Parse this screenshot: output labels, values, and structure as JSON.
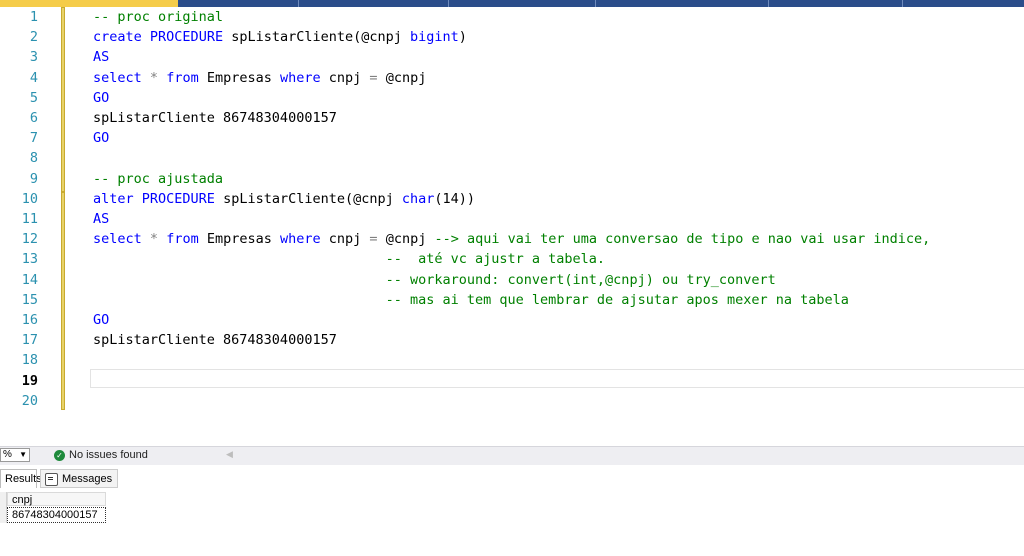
{
  "editor": {
    "line_numbers": [
      "1",
      "2",
      "3",
      "4",
      "5",
      "6",
      "7",
      "8",
      "9",
      "10",
      "11",
      "12",
      "13",
      "14",
      "15",
      "16",
      "17",
      "18",
      "19",
      "20"
    ],
    "current_line": "19",
    "lines": [
      [
        {
          "t": "-- proc original",
          "c": "cm"
        }
      ],
      [
        {
          "t": "create",
          "c": "kw"
        },
        {
          "t": " "
        },
        {
          "t": "PROCEDURE",
          "c": "kw"
        },
        {
          "t": " spListarCliente(@cnpj "
        },
        {
          "t": "bigint",
          "c": "kw"
        },
        {
          "t": ")"
        }
      ],
      [
        {
          "t": "AS",
          "c": "kw"
        }
      ],
      [
        {
          "t": "select",
          "c": "kw"
        },
        {
          "t": " "
        },
        {
          "t": "*",
          "c": "gr"
        },
        {
          "t": " "
        },
        {
          "t": "from",
          "c": "kw"
        },
        {
          "t": " Empresas "
        },
        {
          "t": "where",
          "c": "kw"
        },
        {
          "t": " cnpj "
        },
        {
          "t": "=",
          "c": "gr"
        },
        {
          "t": " @cnpj"
        }
      ],
      [
        {
          "t": "GO",
          "c": "kw"
        }
      ],
      [
        {
          "t": "spListarCliente 86748304000157"
        }
      ],
      [
        {
          "t": "GO",
          "c": "kw"
        }
      ],
      [],
      [
        {
          "t": "-- proc ajustada",
          "c": "cm"
        }
      ],
      [
        {
          "t": "alter",
          "c": "kw"
        },
        {
          "t": " "
        },
        {
          "t": "PROCEDURE",
          "c": "kw"
        },
        {
          "t": " spListarCliente(@cnpj "
        },
        {
          "t": "char",
          "c": "kw"
        },
        {
          "t": "(14))"
        }
      ],
      [
        {
          "t": "AS",
          "c": "kw"
        }
      ],
      [
        {
          "t": "select",
          "c": "kw"
        },
        {
          "t": " "
        },
        {
          "t": "*",
          "c": "gr"
        },
        {
          "t": " "
        },
        {
          "t": "from",
          "c": "kw"
        },
        {
          "t": " Empresas "
        },
        {
          "t": "where",
          "c": "kw"
        },
        {
          "t": " cnpj "
        },
        {
          "t": "=",
          "c": "gr"
        },
        {
          "t": " @cnpj "
        },
        {
          "t": "--> aqui vai ter uma conversao de tipo e nao vai usar indice,",
          "c": "cm"
        }
      ],
      [
        {
          "t": "                                    "
        },
        {
          "t": "--  até vc ajustr a tabela.",
          "c": "cm"
        }
      ],
      [
        {
          "t": "                                    "
        },
        {
          "t": "-- workaround: convert(int,@cnpj) ou try_convert",
          "c": "cm"
        }
      ],
      [
        {
          "t": "                                    "
        },
        {
          "t": "-- mas ai tem que lembrar de ajsutar apos mexer na tabela",
          "c": "cm"
        }
      ],
      [
        {
          "t": "GO",
          "c": "kw"
        }
      ],
      [
        {
          "t": "spListarCliente 86748304000157"
        }
      ],
      [],
      [],
      []
    ]
  },
  "statusbar": {
    "zoom": "%",
    "issues_text": "No issues found"
  },
  "results": {
    "tabs": {
      "results": "Results",
      "messages": "Messages"
    },
    "column": "cnpj",
    "value": "86748304000157"
  }
}
